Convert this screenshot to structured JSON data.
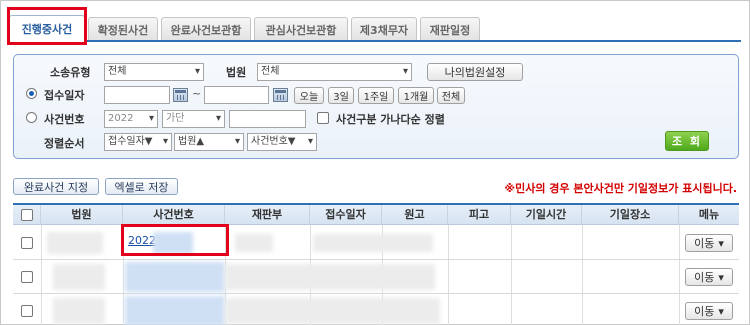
{
  "tabs": [
    {
      "label": "진행중사건",
      "active": true
    },
    {
      "label": "확정된사건",
      "active": false
    },
    {
      "label": "완료사건보관함",
      "active": false
    },
    {
      "label": "관심사건보관함",
      "active": false
    },
    {
      "label": "제3채무자",
      "active": false
    },
    {
      "label": "재판일정",
      "active": false
    }
  ],
  "search": {
    "case_type_label": "소송유형",
    "case_type_value": "전체",
    "court_label": "법원",
    "court_value": "전체",
    "my_court_button": "나의법원설정",
    "receipt_date_label": "접수일자",
    "receipt_date_selected": true,
    "range_separator": "~",
    "date_buttons": [
      "오늘",
      "3일",
      "1주일",
      "1개월",
      "전체"
    ],
    "case_number_label": "사건번호",
    "case_number_selected": false,
    "year_value": "2022",
    "case_kind_value": "가단",
    "sort_checkbox_label": "사건구분 가나다순 정렬",
    "sort_order_label": "정렬순서",
    "sort_options": [
      "접수일자▼",
      "법원▲",
      "사건번호▼"
    ],
    "lookup_button": "조 회"
  },
  "actions": {
    "complete_button": "완료사건 지정",
    "excel_button": "엑셀로 저장",
    "notice": "※민사의 경우 본안사건만 기일정보가 표시됩니다."
  },
  "table": {
    "columns": [
      "법원",
      "사건번호",
      "재판부",
      "접수일자",
      "원고",
      "피고",
      "기일시간",
      "기일장소",
      "메뉴"
    ],
    "rows": [
      {
        "case_number": "2022",
        "menu": "이동"
      },
      {
        "case_number": "",
        "menu": "이동"
      },
      {
        "case_number": "",
        "menu": "이동"
      }
    ]
  },
  "colors": {
    "accent": "#2f6fb4",
    "highlight": "#e3001b",
    "lookup": "#5cb32a",
    "notice": "#d40000"
  }
}
